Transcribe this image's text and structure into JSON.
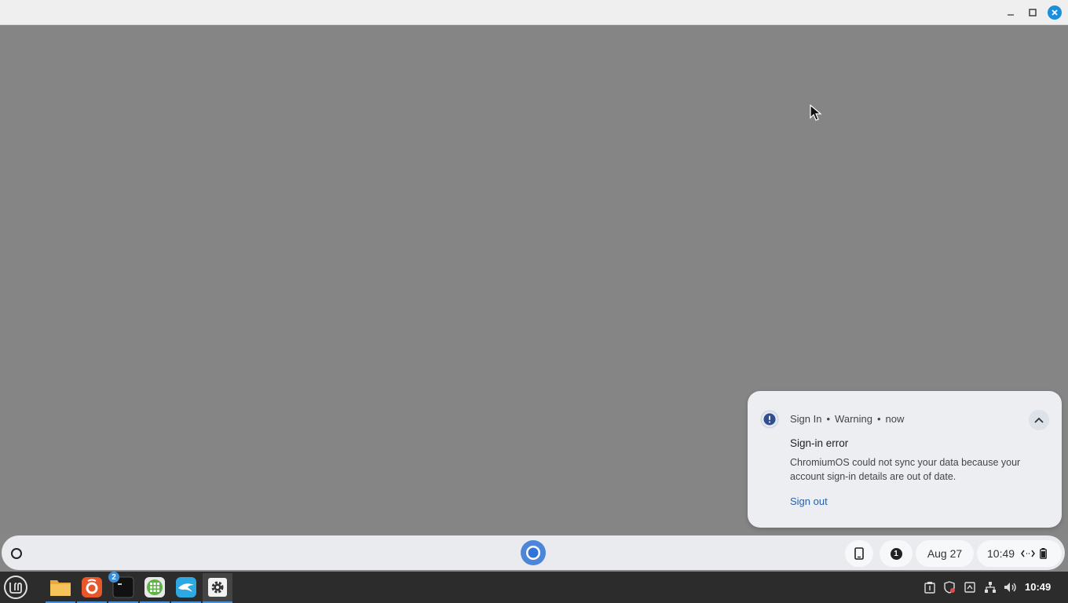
{
  "notification": {
    "source": "Sign In",
    "severity": "Warning",
    "time": "now",
    "separator": "•",
    "title": "Sign-in error",
    "body": "ChromiumOS could not sync your data because your account sign-in details are out of date.",
    "action": "Sign out"
  },
  "shelf": {
    "notification_count": "1",
    "date": "Aug 27",
    "time": "10:49"
  },
  "panel": {
    "terminal_badge": "2",
    "clock": "10:49"
  },
  "colors": {
    "desktop": "#858585",
    "accent_blue": "#1a8fdc",
    "link": "#2a5fab"
  }
}
